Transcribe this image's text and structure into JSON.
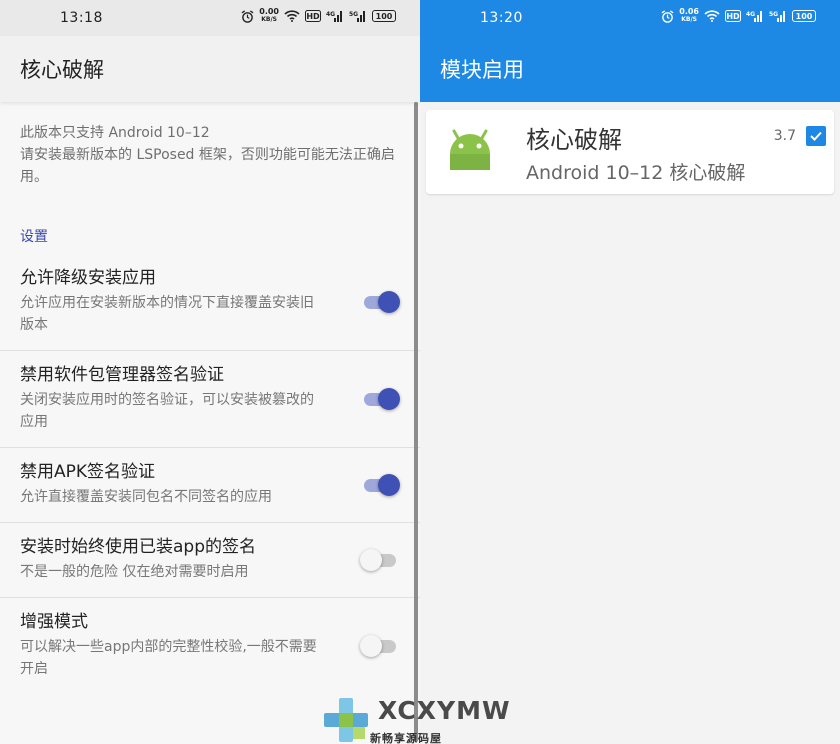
{
  "left": {
    "status": {
      "time": "13:18",
      "net_speed": "0.00",
      "net_unit": "KB/S",
      "battery": "100"
    },
    "title": "核心破解",
    "notice": "此版本只支持 Android 10–12\n请安装最新版本的 LSPosed 框架，否则功能可能无法正确启用。",
    "section_header": "设置",
    "settings": [
      {
        "title": "允许降级安装应用",
        "summary": "允许应用在安装新版本的情况下直接覆盖安装旧版本",
        "enabled": true
      },
      {
        "title": "禁用软件包管理器签名验证",
        "summary": "关闭安装应用时的签名验证，可以安装被篡改的应用",
        "enabled": true
      },
      {
        "title": "禁用APK签名验证",
        "summary": "允许直接覆盖安装同包名不同签名的应用",
        "enabled": true
      },
      {
        "title": "安装时始终使用已装app的签名",
        "summary": "不是一般的危险 仅在绝对需要时启用",
        "enabled": false
      },
      {
        "title": "增强模式",
        "summary": "可以解决一些app内部的完整性校验,一般不需要开启",
        "enabled": false
      }
    ]
  },
  "right": {
    "status": {
      "time": "13:20",
      "net_speed": "0.06",
      "net_unit": "KB/S",
      "battery": "100"
    },
    "title": "模块启用",
    "module": {
      "name": "核心破解",
      "description": "Android 10–12 核心破解",
      "version": "3.7",
      "checked": true
    }
  },
  "watermark": {
    "brand": "XCXYMW",
    "sub": "新畅享源码屋"
  },
  "colors": {
    "accent": "#3f51b5",
    "blue_bar": "#1e88e5",
    "section": "#3949ab"
  },
  "icons": [
    "alarm-icon",
    "wifi-icon",
    "hd-icon",
    "signal-icon",
    "battery-icon",
    "android-icon",
    "checkbox-icon"
  ]
}
